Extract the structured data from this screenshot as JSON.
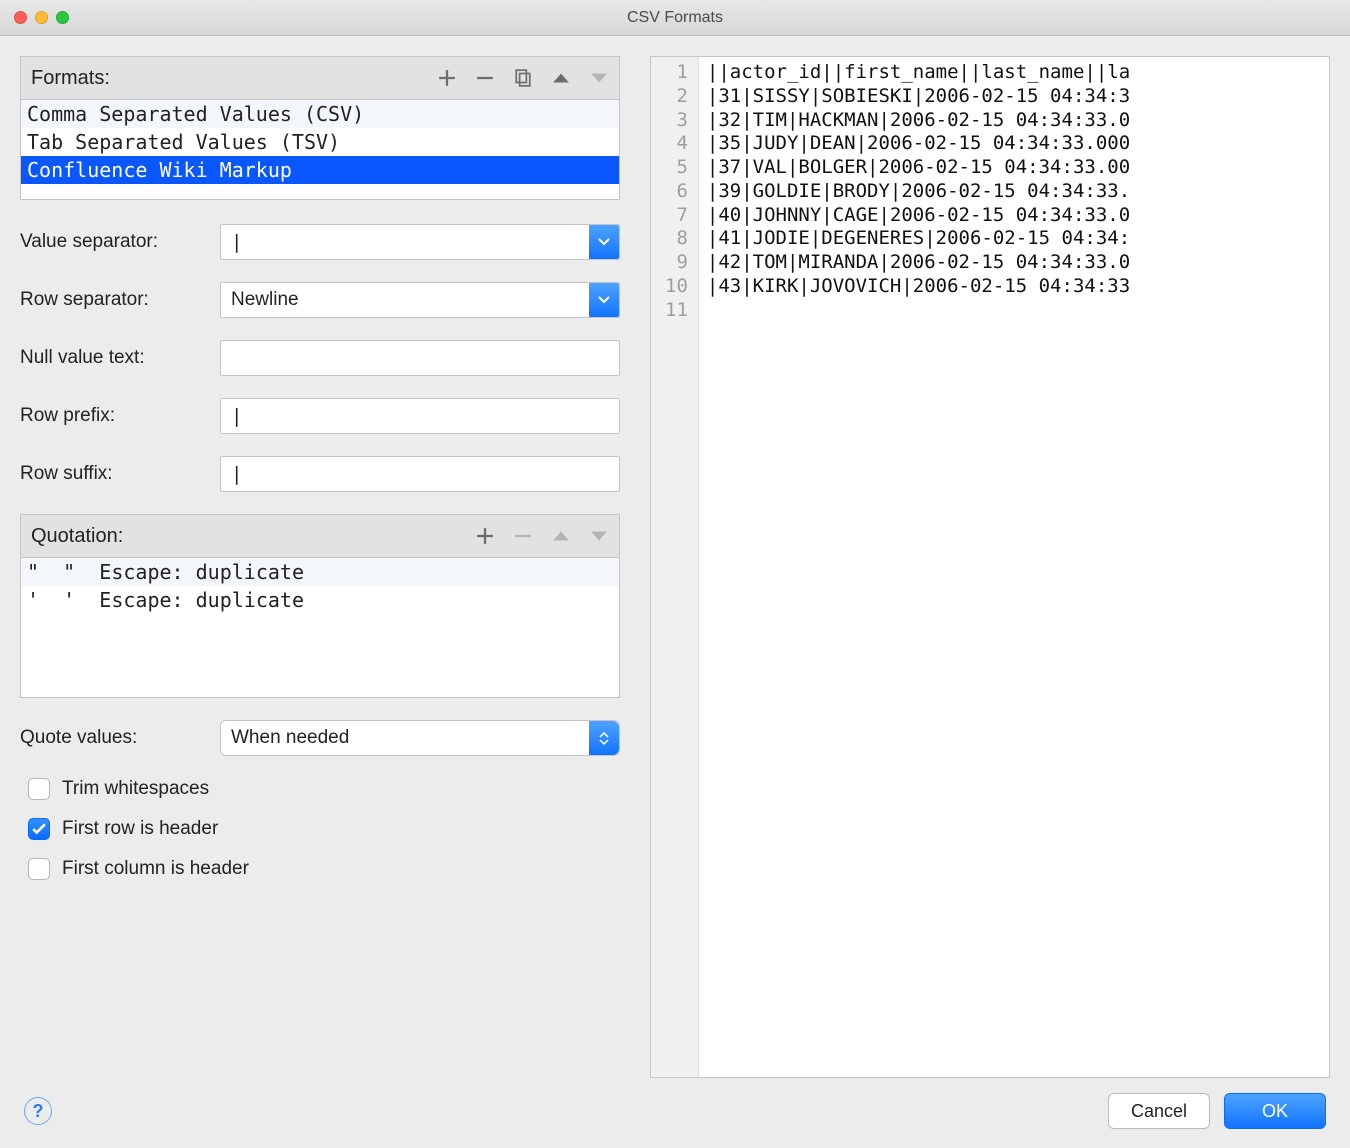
{
  "window": {
    "title": "CSV Formats"
  },
  "formats": {
    "label": "Formats:",
    "items": [
      {
        "label": "Comma Separated Values (CSV)",
        "selected": false
      },
      {
        "label": "Tab Separated Values (TSV)",
        "selected": false
      },
      {
        "label": "Confluence Wiki Markup",
        "selected": true
      }
    ]
  },
  "fields": {
    "value_separator": {
      "label": "Value separator:",
      "value": "|"
    },
    "row_separator": {
      "label": "Row separator:",
      "value": "Newline"
    },
    "null_value_text": {
      "label": "Null value text:",
      "value": ""
    },
    "row_prefix": {
      "label": "Row prefix:",
      "value": "|"
    },
    "row_suffix": {
      "label": "Row suffix:",
      "value": "|"
    }
  },
  "quotation": {
    "label": "Quotation:",
    "rows": [
      {
        "open": "\"",
        "close": "\"",
        "escape_label": "Escape:",
        "escape": "duplicate"
      },
      {
        "open": "'",
        "close": "'",
        "escape_label": "Escape:",
        "escape": "duplicate"
      }
    ]
  },
  "quote_values": {
    "label": "Quote values:",
    "value": "When needed"
  },
  "checkboxes": {
    "trim_whitespace": {
      "label": "Trim whitespaces",
      "checked": false
    },
    "first_row_header": {
      "label": "First row is header",
      "checked": true
    },
    "first_col_header": {
      "label": "First column is header",
      "checked": false
    }
  },
  "preview": {
    "lines": [
      "||actor_id||first_name||last_name||la",
      "|31|SISSY|SOBIESKI|2006-02-15 04:34:3",
      "|32|TIM|HACKMAN|2006-02-15 04:34:33.0",
      "|35|JUDY|DEAN|2006-02-15 04:34:33.000",
      "|37|VAL|BOLGER|2006-02-15 04:34:33.00",
      "|39|GOLDIE|BRODY|2006-02-15 04:34:33.",
      "|40|JOHNNY|CAGE|2006-02-15 04:34:33.0",
      "|41|JODIE|DEGENERES|2006-02-15 04:34:",
      "|42|TOM|MIRANDA|2006-02-15 04:34:33.0",
      "|43|KIRK|JOVOVICH|2006-02-15 04:34:33",
      ""
    ]
  },
  "footer": {
    "ok": "OK",
    "cancel": "Cancel"
  }
}
